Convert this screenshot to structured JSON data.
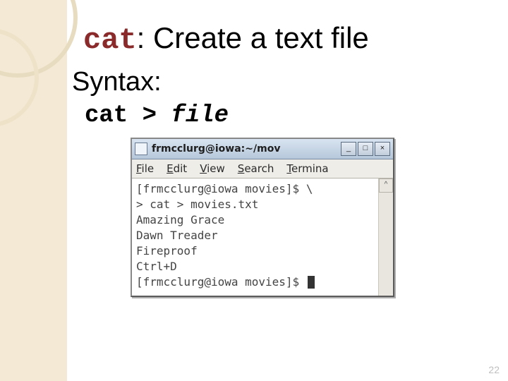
{
  "title_cmd": "cat",
  "title_rest": ": Create a text file",
  "syntax_label": "Syntax:",
  "syntax_cmd": "cat > ",
  "syntax_arg": "file",
  "terminal": {
    "window_title": "frmcclurg@iowa:~/mov",
    "menu": {
      "file": "File",
      "edit": "Edit",
      "view": "View",
      "search": "Search",
      "terminal": "Termina"
    },
    "btn_min": "_",
    "btn_max": "□",
    "btn_close": "×",
    "scroll_up": "^",
    "lines": {
      "l0": "[frmcclurg@iowa movies]$ \\",
      "l1": "> cat > movies.txt",
      "l2": "Amazing Grace",
      "l3": "Dawn Treader",
      "l4": "Fireproof",
      "l5": "Ctrl+D",
      "l6": "[frmcclurg@iowa movies]$ "
    }
  },
  "page_number": "22"
}
